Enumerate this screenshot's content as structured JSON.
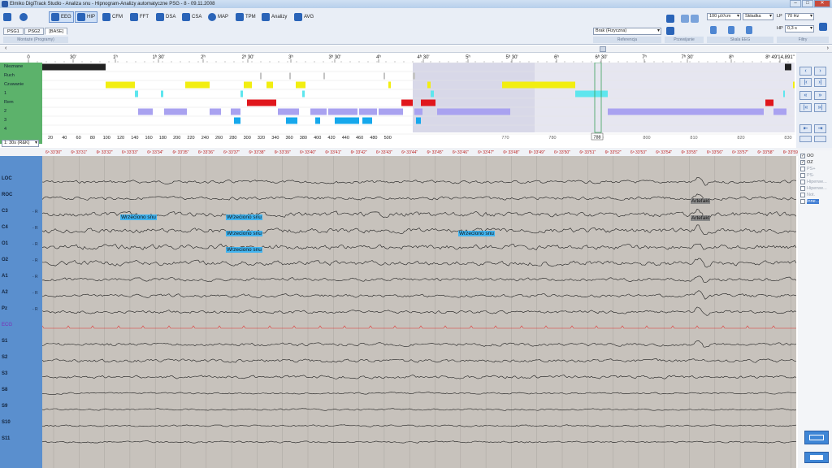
{
  "window": {
    "title": "Elmiko DigiTrack Studio  -  Analiza snu  -  Hipnogram-Analizy automatyczne PSG  -  8  -  09.11.2008",
    "controls": [
      "–",
      "□",
      "✕"
    ]
  },
  "toolbar": {
    "buttons": [
      {
        "label": "",
        "icon": "eye-icon"
      },
      {
        "label": "EEG",
        "icon": "eeg-icon",
        "active": true
      },
      {
        "label": "HIP",
        "icon": "hypnogram-icon",
        "active": true
      },
      {
        "label": "CFM",
        "icon": "cfm-icon"
      },
      {
        "label": "FFT",
        "icon": "fft-icon"
      },
      {
        "label": "DSA",
        "icon": "dsa-icon"
      },
      {
        "label": "CSA",
        "icon": "csa-icon"
      },
      {
        "label": "MAP",
        "icon": "map-icon"
      },
      {
        "label": "TPM",
        "icon": "tpm-icon"
      },
      {
        "label": "Analizy",
        "icon": "analysis-icon"
      },
      {
        "label": "AVG",
        "icon": "sum-icon"
      }
    ],
    "tabs": [
      "PSG1",
      "PSG2",
      "[BASE]"
    ],
    "group_labels": {
      "montage": "Montaże (Programy)",
      "reference": "Referencja",
      "view": "Przewijanie",
      "scale": "Skala EEG",
      "filters": "Filtry"
    },
    "reference_value": "Brak (Fizyczna)",
    "sensitivity": "100 µV/cm",
    "component": "Składka",
    "lp_label": "LP",
    "lp_value": "70 Hz",
    "hp_label": "HP",
    "hp_value": "0,3 s"
  },
  "hypnogram": {
    "time_ticks": [
      "0",
      "30'",
      "1ʰ",
      "1ʰ 30'",
      "2ʰ",
      "2ʰ 30'",
      "3ʰ",
      "3ʰ 30'",
      "4ʰ",
      "4ʰ 30'",
      "5ʰ",
      "5ʰ 30'",
      "6ʰ",
      "6ʰ 30'",
      "7ʰ",
      "7ʰ 30'",
      "8ʰ",
      "8ʰ 49'14,891\""
    ],
    "stages": [
      "Nieznane",
      "Ruch",
      "Czuwanie",
      "1",
      "Rem",
      "2",
      "3",
      "4"
    ],
    "epoch_ticks": [
      "20",
      "40",
      "60",
      "80",
      "100",
      "120",
      "140",
      "160",
      "180",
      "200",
      "220",
      "240",
      "260",
      "280",
      "300",
      "320",
      "340",
      "360",
      "380",
      "400",
      "420",
      "440",
      "460",
      "480",
      "500"
    ],
    "zoom_ticks": [
      "770",
      "780",
      "790",
      "800",
      "810",
      "820",
      "830"
    ],
    "current_epoch": "788",
    "epoch_len": "1: 30s (R&K)"
  },
  "eeg": {
    "time_labels": [
      "6ʰ 33'30\"",
      "6ʰ 33'31\"",
      "6ʰ 33'32\"",
      "6ʰ 33'33\"",
      "6ʰ 33'34\"",
      "6ʰ 33'35\"",
      "6ʰ 33'36\"",
      "6ʰ 33'37\"",
      "6ʰ 33'38\"",
      "6ʰ 33'39\"",
      "6ʰ 33'40\"",
      "6ʰ 33'41\"",
      "6ʰ 33'42\"",
      "6ʰ 33'43\"",
      "6ʰ 33'44\"",
      "6ʰ 33'45\"",
      "6ʰ 33'46\"",
      "6ʰ 33'47\"",
      "6ʰ 33'48\"",
      "6ʰ 33'49\"",
      "6ʰ 33'50\"",
      "6ʰ 33'51\"",
      "6ʰ 33'52\"",
      "6ʰ 33'53\"",
      "6ʰ 33'54\"",
      "6ʰ 33'55\"",
      "6ʰ 33'56\"",
      "6ʰ 33'57\"",
      "6ʰ 33'58\"",
      "6ʰ 33'59\""
    ],
    "channels": [
      {
        "name": "LOC",
        "ref": ""
      },
      {
        "name": "ROC",
        "ref": ""
      },
      {
        "name": "C3",
        "ref": "- R"
      },
      {
        "name": "C4",
        "ref": "- R"
      },
      {
        "name": "O1",
        "ref": "- R"
      },
      {
        "name": "O2",
        "ref": "- R"
      },
      {
        "name": "A1",
        "ref": "- R"
      },
      {
        "name": "A2",
        "ref": "- R"
      },
      {
        "name": "Pz",
        "ref": "- R"
      },
      {
        "name": "ECG",
        "ref": ""
      },
      {
        "name": "S1",
        "ref": ""
      },
      {
        "name": "S2",
        "ref": ""
      },
      {
        "name": "S3",
        "ref": ""
      },
      {
        "name": "S8",
        "ref": ""
      },
      {
        "name": "S9",
        "ref": ""
      },
      {
        "name": "S10",
        "ref": ""
      },
      {
        "name": "S11",
        "ref": ""
      }
    ],
    "annotations": {
      "spindle": "Wrzeciono snu",
      "artifact": "Artefakt"
    }
  },
  "sidelist": {
    "items": [
      {
        "label": "OO",
        "checked": true
      },
      {
        "label": "OZ",
        "checked": true
      },
      {
        "label": "PS+",
        "checked": false
      },
      {
        "label": "PS-",
        "checked": false
      },
      {
        "label": "Hiperwe...",
        "checked": false
      },
      {
        "label": "Hiperwe...",
        "checked": false
      },
      {
        "label": "Not.",
        "checked": false
      },
      {
        "label": "Inne...",
        "checked": false
      }
    ]
  },
  "colors": {
    "wake": "#f2ee10",
    "stage1": "#5ee6ee",
    "rem": "#e0161c",
    "stage2": "#a9a2f0",
    "stage3": "#16a8ec",
    "unknown": "#222222",
    "movement": "#c4c4c4",
    "ecg": "#e03030"
  }
}
